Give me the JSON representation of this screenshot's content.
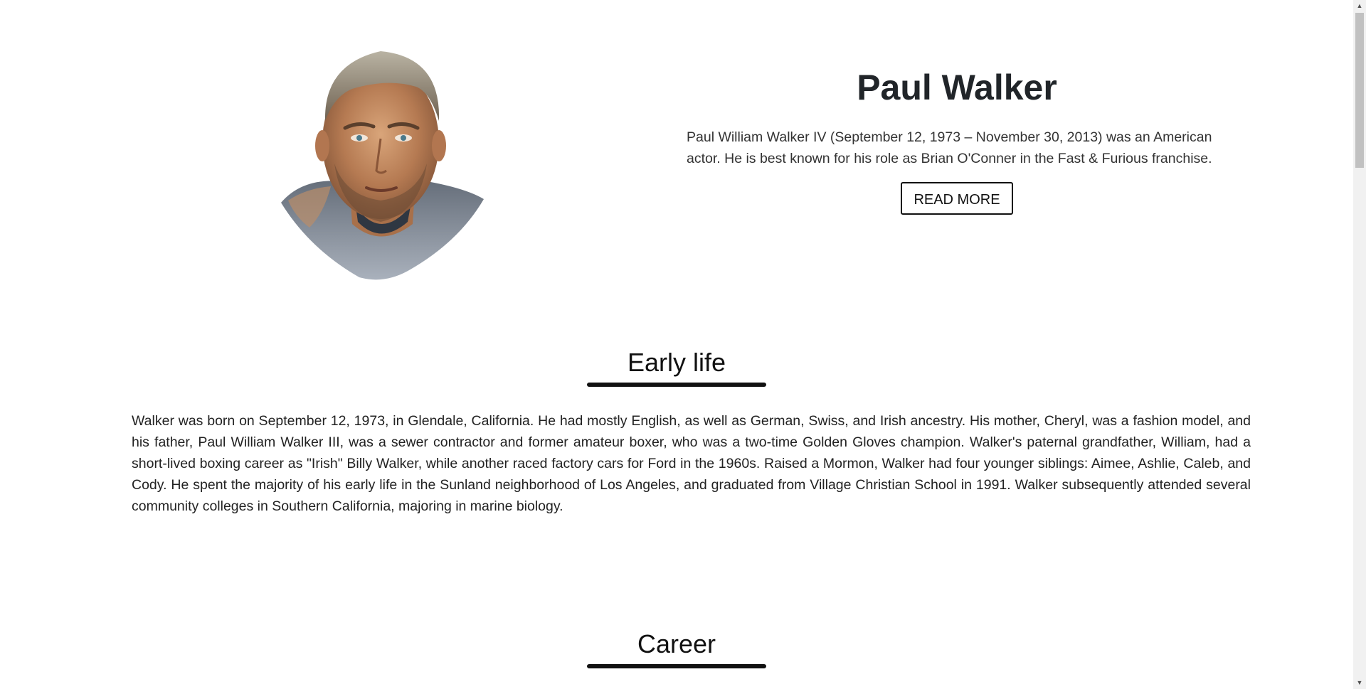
{
  "hero": {
    "name": "Paul Walker",
    "intro": "Paul William Walker IV (September 12, 1973 – November 30, 2013) was an American actor. He is best known for his role as Brian O'Conner in the Fast & Furious franchise.",
    "read_more_label": "READ MORE"
  },
  "sections": [
    {
      "title": "Early life",
      "body": "Walker was born on September 12, 1973, in Glendale, California. He had mostly English, as well as German, Swiss, and Irish ancestry. His mother, Cheryl, was a fashion model, and his father, Paul William Walker III, was a sewer contractor and former amateur boxer, who was a two-time Golden Gloves champion. Walker's paternal grandfather, William, had a short-lived boxing career as \"Irish\" Billy Walker, while another raced factory cars for Ford in the 1960s. Raised a Mormon, Walker had four younger siblings: Aimee, Ashlie, Caleb, and Cody. He spent the majority of his early life in the Sunland neighborhood of Los Angeles, and graduated from Village Christian School in 1991. Walker subsequently attended several community colleges in Southern California, majoring in marine biology."
    },
    {
      "title": "Career"
    }
  ],
  "scrollbar": {
    "up_glyph": "▲",
    "down_glyph": "▼"
  }
}
